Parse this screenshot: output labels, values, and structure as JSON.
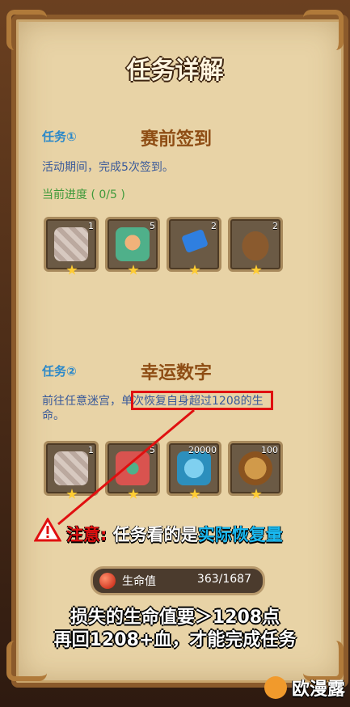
{
  "title": "任务详解",
  "task1": {
    "tag": "任务①",
    "name": "赛前签到",
    "desc": "活动期间，完成5次签到。",
    "progress": "当前进度 ( 0/5 )",
    "rewards": [
      "1",
      "5",
      "2",
      "2"
    ]
  },
  "task2": {
    "tag": "任务②",
    "name": "幸运数字",
    "desc_line1": "前往任意迷宫，单次恢复自身超过1208的生",
    "desc_line2": "命。",
    "rewards": [
      "1",
      "5",
      "20000",
      "100"
    ]
  },
  "warning": {
    "prefix": "注意:",
    "middle": "任务看的是",
    "highlight": "实际恢复量"
  },
  "hp": {
    "label": "生命值",
    "value": "363/1687"
  },
  "footer": {
    "line1": "损失的生命值要＞1208点",
    "line2": "再回1208+血，才能完成任务"
  },
  "watermark": "欧漫露"
}
